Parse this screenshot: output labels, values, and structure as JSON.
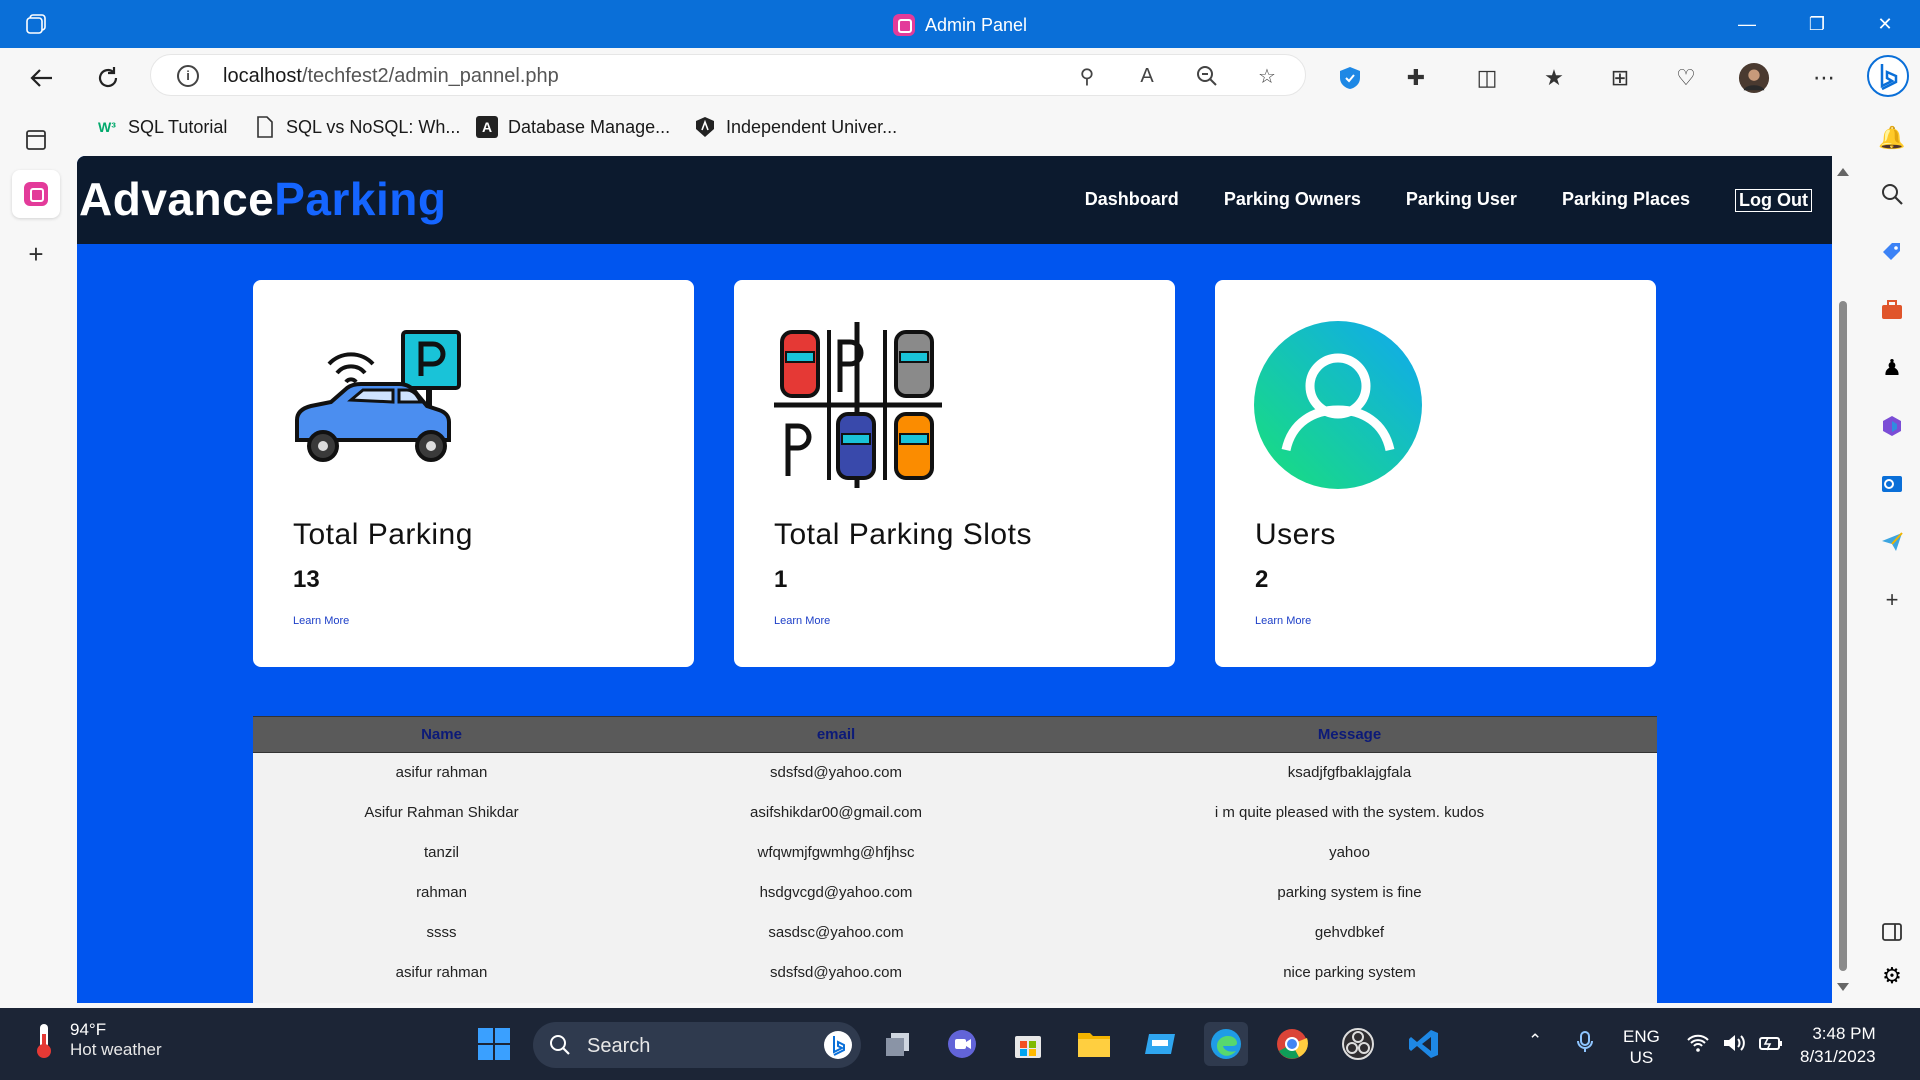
{
  "browser": {
    "window_title": "Admin Panel",
    "url_host": "localhost",
    "url_path": "/techfest2/admin_pannel.php",
    "favorites": [
      {
        "label": "SQL Tutorial",
        "icon": "w3schools-icon"
      },
      {
        "label": "SQL vs NoSQL: Wh...",
        "icon": "document-icon"
      },
      {
        "label": "Database Manage...",
        "icon": "database-icon"
      },
      {
        "label": "Independent Univer...",
        "icon": "university-icon"
      }
    ]
  },
  "site": {
    "logo_main": "Advance",
    "logo_accent": "Parking",
    "nav": [
      "Dashboard",
      "Parking Owners",
      "Parking User",
      "Parking Places",
      "Log Out"
    ]
  },
  "cards": [
    {
      "title": "Total Parking",
      "value": "13",
      "link": "Learn More"
    },
    {
      "title": "Total Parking Slots",
      "value": "1",
      "link": "Learn More"
    },
    {
      "title": "Users",
      "value": "2",
      "link": "Learn More"
    }
  ],
  "messages_table": {
    "headers": [
      "Name",
      "email",
      "Message"
    ],
    "rows": [
      [
        "asifur rahman",
        "sdsfsd@yahoo.com",
        "ksadjfgfbaklajgfala"
      ],
      [
        "Asifur Rahman Shikdar",
        "asifshikdar00@gmail.com",
        "i m quite pleased with the system. kudos"
      ],
      [
        "tanzil",
        "wfqwmjfgwmhg@hfjhsc",
        "yahoo"
      ],
      [
        "rahman",
        "hsdgvcgd@yahoo.com",
        "parking system is fine"
      ],
      [
        "ssss",
        "sasdsc@yahoo.com",
        "gehvdbkef"
      ],
      [
        "asifur rahman",
        "sdsfsd@yahoo.com",
        "nice parking system"
      ]
    ]
  },
  "taskbar": {
    "temperature": "94°F",
    "weather": "Hot weather",
    "search_label": "Search",
    "lang_top": "ENG",
    "lang_bottom": "US",
    "time": "3:48 PM",
    "date": "8/31/2023"
  },
  "colors": {
    "titlebar": "#0a6fd8",
    "page_bg": "#0055ef",
    "site_nav": "#0c1a2e",
    "logo_accent": "#1565ff",
    "taskbar": "#1c2536"
  }
}
